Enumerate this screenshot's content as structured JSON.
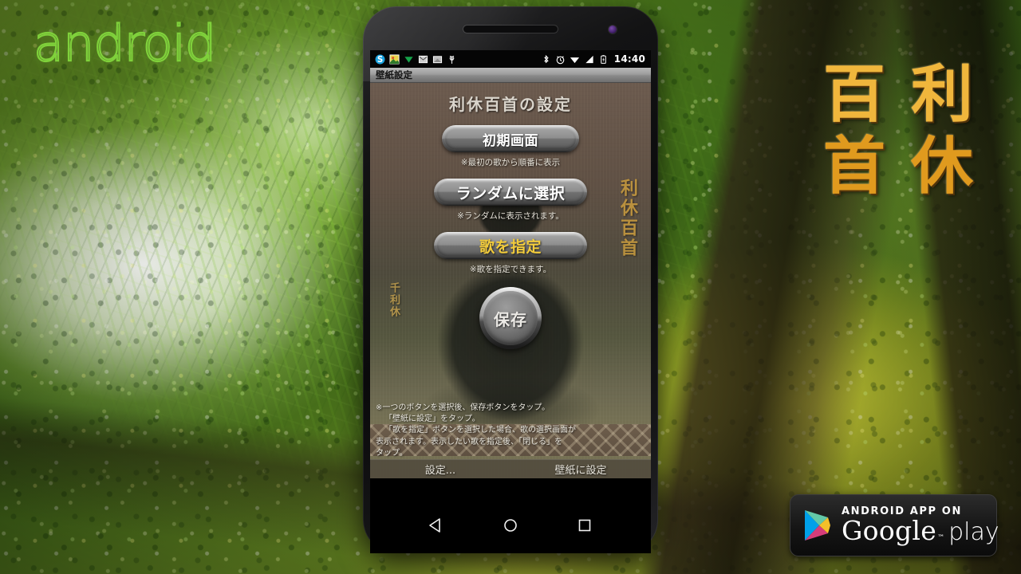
{
  "overlay": {
    "android_wordmark": "android",
    "calligraphy": [
      "百",
      "利",
      "首",
      "休"
    ],
    "google_play_badge": {
      "top_line": "ANDROID APP ON",
      "brand": "Google",
      "trademark": "™",
      "product": "play",
      "triangle_icon": "play-triangle-icon"
    }
  },
  "phone": {
    "earpiece_icon": "earpiece-speaker",
    "camera_icon": "front-camera",
    "bottom_speaker_icon": "bottom-speaker"
  },
  "status_bar": {
    "left_icons": [
      "skype-icon",
      "photo-app-icon",
      "download-arrow-icon",
      "mail-icon",
      "envelope-icon",
      "android-robot-icon"
    ],
    "right_icons": [
      "bluetooth-icon",
      "alarm-icon",
      "wifi-icon",
      "signal-icon",
      "battery-icon"
    ],
    "clock": "14:40"
  },
  "title_bar": {
    "title": "壁紙設定"
  },
  "app": {
    "heading": "利休百首の設定",
    "buttons": [
      {
        "label": "初期画面",
        "note": "※最初の歌から順番に表示",
        "color": "#ffffff"
      },
      {
        "label": "ランダムに選択",
        "note": "※ランダムに表示されます。",
        "color": "#ffffff"
      },
      {
        "label": "歌を指定",
        "note": "※歌を指定できます。",
        "color": "#f2cc3c"
      }
    ],
    "save_button": "保存",
    "vertical_text_right": "利休百首",
    "vertical_text_left": "千利休",
    "instructions": [
      "※一つのボタンを選択後、保存ボタンをタップ。",
      "「壁紙に設定」をタップ。",
      "「歌を指定」ボタンを選択した場合、歌の選択画面が",
      "表示されます。表示したい歌を指定後、「閉じる」を",
      "タップ。"
    ],
    "bottom_bar": {
      "settings": "設定...",
      "set_wallpaper": "壁紙に設定"
    }
  },
  "nav_bar": {
    "back_icon": "back-triangle-icon",
    "home_icon": "home-circle-icon",
    "recents_icon": "recents-square-icon"
  },
  "colors": {
    "android_green": "#7fd13b",
    "calligraphy_gold": "#f0b63c",
    "app_brown": "#5f5044",
    "highlight_yellow": "#f2cc3c"
  }
}
